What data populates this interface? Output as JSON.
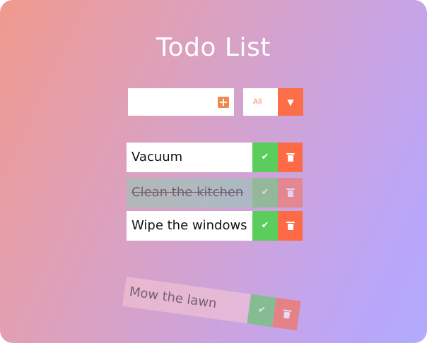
{
  "app": {
    "title": "Todo List"
  },
  "add_form": {
    "input_value": "",
    "input_placeholder": "",
    "add_icon": "plus-square-icon",
    "filter_selected": "All",
    "filter_arrow": "▼"
  },
  "todos": [
    {
      "text": "Vacuum",
      "completed": false
    },
    {
      "text": "Clean the kitchen",
      "completed": true
    },
    {
      "text": "Wipe the windows",
      "completed": false
    },
    {
      "text": "Mow the lawn",
      "completed": false,
      "state": "being deleted"
    }
  ],
  "icons": {
    "check": "✔",
    "check_name": "check-icon",
    "trash_name": "trash-icon"
  },
  "colors": {
    "gradient_start": "#f09a8e",
    "gradient_end": "#b1acfb",
    "accent": "#fc6e47",
    "complete": "#5acd5c",
    "text": "#111111"
  }
}
